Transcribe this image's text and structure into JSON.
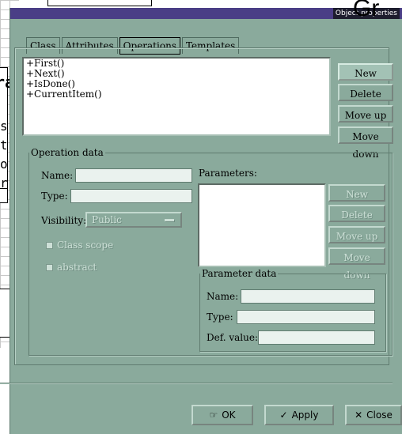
{
  "window": {
    "title": "Object properties"
  },
  "background": {
    "heading_fragment": "Gr",
    "class_fragment": "ra",
    "attr_lines": [
      "s",
      "t",
      "o",
      "r"
    ]
  },
  "tabs": [
    {
      "label": "Class",
      "active": false
    },
    {
      "label": "Attributes",
      "active": false
    },
    {
      "label": "Operations",
      "active": true
    },
    {
      "label": "Templates",
      "active": false
    }
  ],
  "operations_list": [
    "+First()",
    "+Next()",
    "+IsDone()",
    "+CurrentItem()"
  ],
  "list_buttons": {
    "new": "New",
    "delete": "Delete",
    "move_up": "Move up",
    "move_down": "Move down"
  },
  "operation_data": {
    "legend": "Operation data",
    "name_label": "Name:",
    "name_value": "",
    "type_label": "Type:",
    "type_value": "",
    "visibility_label": "Visibility:",
    "visibility_value": "Public",
    "class_scope_label": "Class scope",
    "abstract_label": "abstract"
  },
  "parameters": {
    "label": "Parameters:",
    "buttons": {
      "new": "New",
      "delete": "Delete",
      "move_up": "Move up",
      "move_down": "Move down"
    }
  },
  "parameter_data": {
    "legend": "Parameter data",
    "name_label": "Name:",
    "type_label": "Type:",
    "def_value_label": "Def. value:"
  },
  "footer": {
    "ok": "OK",
    "apply": "Apply",
    "close": "Close"
  },
  "icons": {
    "ok": "hand-pointer-icon",
    "apply": "checkmark-icon",
    "close": "x-icon"
  }
}
